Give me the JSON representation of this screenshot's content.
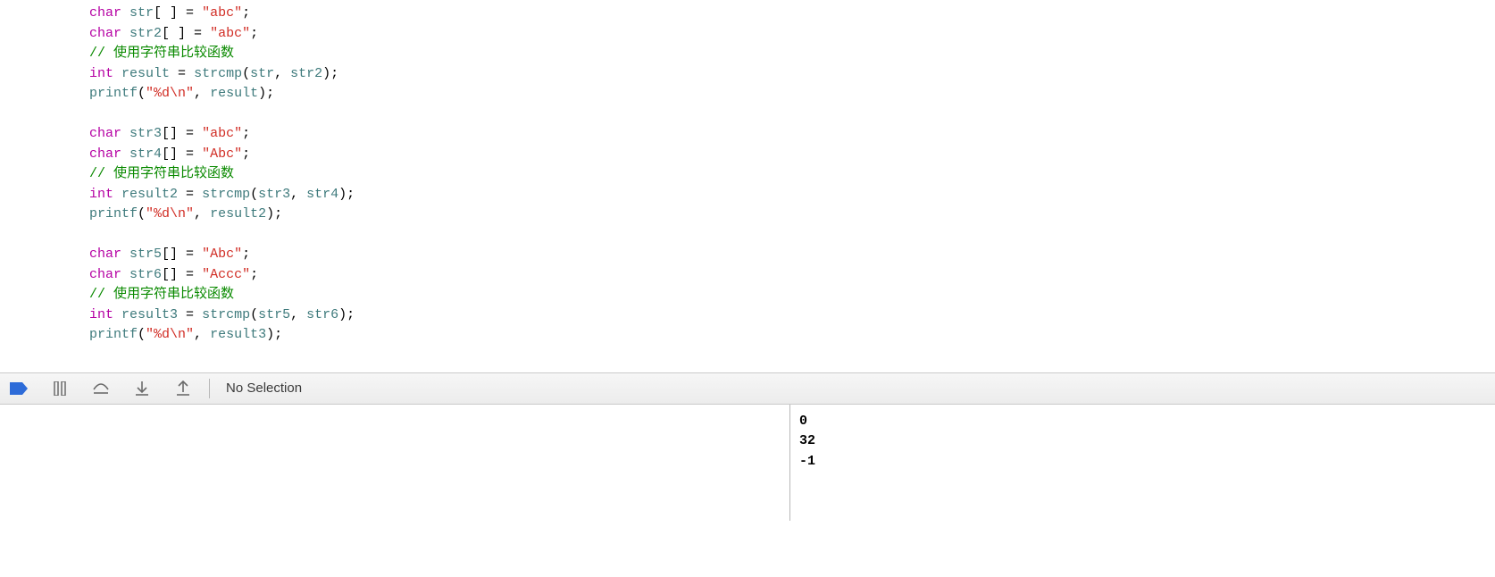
{
  "code": {
    "lines": [
      [
        {
          "cls": "tok-keyword",
          "t": "char"
        },
        {
          "cls": "tok-plain",
          "t": " "
        },
        {
          "cls": "tok-ident",
          "t": "str"
        },
        {
          "cls": "tok-plain",
          "t": "[ ] = "
        },
        {
          "cls": "tok-string",
          "t": "\"abc\""
        },
        {
          "cls": "tok-plain",
          "t": ";"
        }
      ],
      [
        {
          "cls": "tok-keyword",
          "t": "char"
        },
        {
          "cls": "tok-plain",
          "t": " "
        },
        {
          "cls": "tok-ident",
          "t": "str2"
        },
        {
          "cls": "tok-plain",
          "t": "[ ] = "
        },
        {
          "cls": "tok-string",
          "t": "\"abc\""
        },
        {
          "cls": "tok-plain",
          "t": ";"
        }
      ],
      [
        {
          "cls": "tok-comment",
          "t": "// 使用字符串比较函数"
        }
      ],
      [
        {
          "cls": "tok-keyword",
          "t": "int"
        },
        {
          "cls": "tok-plain",
          "t": " "
        },
        {
          "cls": "tok-ident",
          "t": "result"
        },
        {
          "cls": "tok-plain",
          "t": " = "
        },
        {
          "cls": "tok-ident",
          "t": "strcmp"
        },
        {
          "cls": "tok-plain",
          "t": "("
        },
        {
          "cls": "tok-ident",
          "t": "str"
        },
        {
          "cls": "tok-plain",
          "t": ", "
        },
        {
          "cls": "tok-ident",
          "t": "str2"
        },
        {
          "cls": "tok-plain",
          "t": ");"
        }
      ],
      [
        {
          "cls": "tok-ident",
          "t": "printf"
        },
        {
          "cls": "tok-plain",
          "t": "("
        },
        {
          "cls": "tok-string",
          "t": "\"%d\\n\""
        },
        {
          "cls": "tok-plain",
          "t": ", "
        },
        {
          "cls": "tok-ident",
          "t": "result"
        },
        {
          "cls": "tok-plain",
          "t": ");"
        }
      ],
      [],
      [
        {
          "cls": "tok-keyword",
          "t": "char"
        },
        {
          "cls": "tok-plain",
          "t": " "
        },
        {
          "cls": "tok-ident",
          "t": "str3"
        },
        {
          "cls": "tok-plain",
          "t": "[] = "
        },
        {
          "cls": "tok-string",
          "t": "\"abc\""
        },
        {
          "cls": "tok-plain",
          "t": ";"
        }
      ],
      [
        {
          "cls": "tok-keyword",
          "t": "char"
        },
        {
          "cls": "tok-plain",
          "t": " "
        },
        {
          "cls": "tok-ident",
          "t": "str4"
        },
        {
          "cls": "tok-plain",
          "t": "[] = "
        },
        {
          "cls": "tok-string",
          "t": "\"Abc\""
        },
        {
          "cls": "tok-plain",
          "t": ";"
        }
      ],
      [
        {
          "cls": "tok-comment",
          "t": "// 使用字符串比较函数"
        }
      ],
      [
        {
          "cls": "tok-keyword",
          "t": "int"
        },
        {
          "cls": "tok-plain",
          "t": " "
        },
        {
          "cls": "tok-ident",
          "t": "result2"
        },
        {
          "cls": "tok-plain",
          "t": " = "
        },
        {
          "cls": "tok-ident",
          "t": "strcmp"
        },
        {
          "cls": "tok-plain",
          "t": "("
        },
        {
          "cls": "tok-ident",
          "t": "str3"
        },
        {
          "cls": "tok-plain",
          "t": ", "
        },
        {
          "cls": "tok-ident",
          "t": "str4"
        },
        {
          "cls": "tok-plain",
          "t": ");"
        }
      ],
      [
        {
          "cls": "tok-ident",
          "t": "printf"
        },
        {
          "cls": "tok-plain",
          "t": "("
        },
        {
          "cls": "tok-string",
          "t": "\"%d\\n\""
        },
        {
          "cls": "tok-plain",
          "t": ", "
        },
        {
          "cls": "tok-ident",
          "t": "result2"
        },
        {
          "cls": "tok-plain",
          "t": ");"
        }
      ],
      [],
      [
        {
          "cls": "tok-keyword",
          "t": "char"
        },
        {
          "cls": "tok-plain",
          "t": " "
        },
        {
          "cls": "tok-ident",
          "t": "str5"
        },
        {
          "cls": "tok-plain",
          "t": "[] = "
        },
        {
          "cls": "tok-string",
          "t": "\"Abc\""
        },
        {
          "cls": "tok-plain",
          "t": ";"
        }
      ],
      [
        {
          "cls": "tok-keyword",
          "t": "char"
        },
        {
          "cls": "tok-plain",
          "t": " "
        },
        {
          "cls": "tok-ident",
          "t": "str6"
        },
        {
          "cls": "tok-plain",
          "t": "[] = "
        },
        {
          "cls": "tok-string",
          "t": "\"Accc\""
        },
        {
          "cls": "tok-plain",
          "t": ";"
        }
      ],
      [
        {
          "cls": "tok-comment",
          "t": "// 使用字符串比较函数"
        }
      ],
      [
        {
          "cls": "tok-keyword",
          "t": "int"
        },
        {
          "cls": "tok-plain",
          "t": " "
        },
        {
          "cls": "tok-ident",
          "t": "result3"
        },
        {
          "cls": "tok-plain",
          "t": " = "
        },
        {
          "cls": "tok-ident",
          "t": "strcmp"
        },
        {
          "cls": "tok-plain",
          "t": "("
        },
        {
          "cls": "tok-ident",
          "t": "str5"
        },
        {
          "cls": "tok-plain",
          "t": ", "
        },
        {
          "cls": "tok-ident",
          "t": "str6"
        },
        {
          "cls": "tok-plain",
          "t": ");"
        }
      ],
      [
        {
          "cls": "tok-ident",
          "t": "printf"
        },
        {
          "cls": "tok-plain",
          "t": "("
        },
        {
          "cls": "tok-string",
          "t": "\"%d\\n\""
        },
        {
          "cls": "tok-plain",
          "t": ", "
        },
        {
          "cls": "tok-ident",
          "t": "result3"
        },
        {
          "cls": "tok-plain",
          "t": ");"
        }
      ]
    ]
  },
  "debugbar": {
    "status": "No Selection"
  },
  "console": {
    "output": "0\n32\n-1"
  }
}
